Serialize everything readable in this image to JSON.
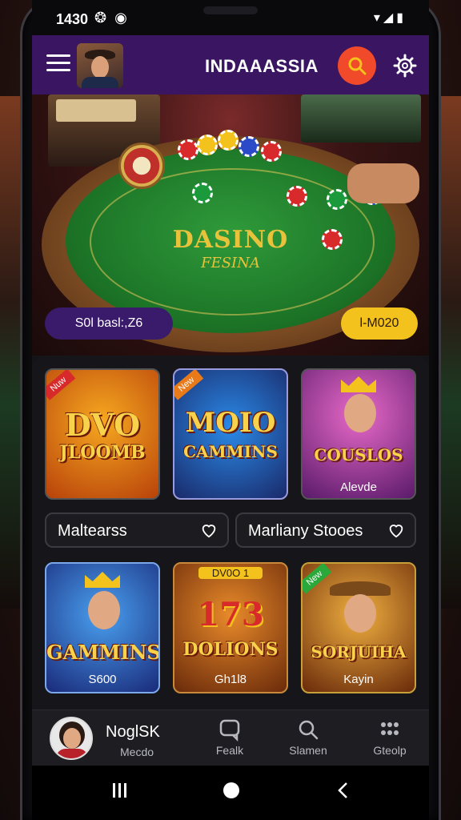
{
  "status_bar": {
    "time": "1430"
  },
  "app": {
    "title": "INDAAASSIA"
  },
  "hero": {
    "table_title": "DASINO",
    "table_subtitle": "FESINA",
    "left_pill": "S0l basl:,Z6",
    "right_pill": "l-M020"
  },
  "games_row1": [
    {
      "title_line1": "DVO",
      "title_line2": "JLOOMB",
      "ribbon": "Nuw",
      "subtitle": ""
    },
    {
      "title_line1": "MOIO",
      "title_line2": "CAMMINS",
      "ribbon": "New",
      "subtitle": ""
    },
    {
      "title_line1": "COUSLOS",
      "title_line2": "",
      "ribbon": "",
      "subtitle": "Alevde"
    }
  ],
  "category_pills": [
    {
      "label": "Maltearss"
    },
    {
      "label": "Marliany Stooes"
    }
  ],
  "games_row2": [
    {
      "title_line1": "GAMMINS",
      "ribbon": "",
      "subtitle": "S600"
    },
    {
      "title_line1": "DOLIONS",
      "ribbon": "DV0O 1",
      "digits": "173",
      "subtitle": "Gh1l8"
    },
    {
      "title_line1": "SORJUIHA",
      "ribbon": "New",
      "subtitle": "Kayin"
    }
  ],
  "bottom_nav": {
    "user_name": "NoglSK",
    "first_label": "Mecdo",
    "items": [
      {
        "label": "Fealk",
        "icon": "chat-icon"
      },
      {
        "label": "Slamen",
        "icon": "search-icon"
      },
      {
        "label": "Gteolp",
        "icon": "grid-icon"
      }
    ]
  },
  "colors": {
    "top_bar": "#3a1662",
    "accent_orange": "#f04a2a",
    "accent_yellow": "#f4c21c",
    "felt": "#1f7a2a"
  }
}
